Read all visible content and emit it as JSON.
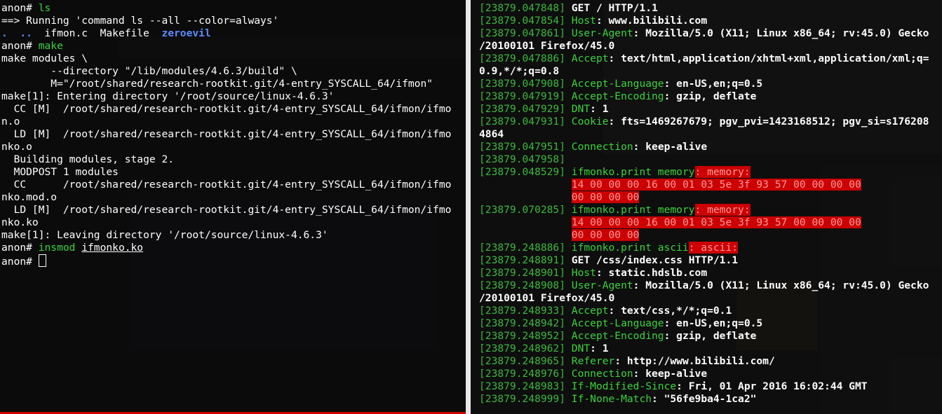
{
  "left_terminal": {
    "lines": [
      [
        {
          "t": "anon# ",
          "c": "prompt"
        },
        {
          "t": "ls",
          "c": "cmd-ls"
        }
      ],
      [
        {
          "t": "==> Running 'command ls --all --color=always'",
          "c": ""
        }
      ],
      [
        {
          "t": ".  ..  ",
          "c": "file-dir"
        },
        {
          "t": "ifmon.c  Makefile  ",
          "c": ""
        },
        {
          "t": "zeroevil",
          "c": "file-dir"
        }
      ],
      [
        {
          "t": "anon# ",
          "c": "prompt"
        },
        {
          "t": "make",
          "c": "cmd-make"
        }
      ],
      [
        {
          "t": "make modules \\",
          "c": ""
        }
      ],
      [
        {
          "t": "        --directory \"/lib/modules/4.6.3/build\" \\",
          "c": ""
        }
      ],
      [
        {
          "t": "        M=\"/root/shared/research-rootkit.git/4-entry_SYSCALL_64/ifmon\"",
          "c": ""
        }
      ],
      [
        {
          "t": "make[1]: Entering directory '/root/source/linux-4.6.3'",
          "c": ""
        }
      ],
      [
        {
          "t": "  CC [M]  /root/shared/research-rootkit.git/4-entry_SYSCALL_64/ifmon/ifmo",
          "c": ""
        }
      ],
      [
        {
          "t": "n.o",
          "c": ""
        }
      ],
      [
        {
          "t": "  LD [M]  /root/shared/research-rootkit.git/4-entry_SYSCALL_64/ifmon/ifmo",
          "c": ""
        }
      ],
      [
        {
          "t": "nko.o",
          "c": ""
        }
      ],
      [
        {
          "t": "  Building modules, stage 2.",
          "c": ""
        }
      ],
      [
        {
          "t": "  MODPOST 1 modules",
          "c": ""
        }
      ],
      [
        {
          "t": "  CC      /root/shared/research-rootkit.git/4-entry_SYSCALL_64/ifmon/ifmo",
          "c": ""
        }
      ],
      [
        {
          "t": "nko.mod.o",
          "c": ""
        }
      ],
      [
        {
          "t": "  LD [M]  /root/shared/research-rootkit.git/4-entry_SYSCALL_64/ifmon/ifmo",
          "c": ""
        }
      ],
      [
        {
          "t": "nko.ko",
          "c": ""
        }
      ],
      [
        {
          "t": "make[1]: Leaving directory '/root/source/linux-4.6.3'",
          "c": ""
        }
      ],
      [
        {
          "t": "anon# ",
          "c": "prompt"
        },
        {
          "t": "insmod ",
          "c": "cmd-insmod"
        },
        {
          "t": "ifmonko.ko",
          "c": "underline"
        }
      ],
      [
        {
          "t": "anon# ",
          "c": "prompt"
        },
        {
          "t": "",
          "c": "cursor"
        }
      ]
    ]
  },
  "right_terminal": {
    "lines": [
      [
        {
          "t": "[23879.047848] ",
          "c": "ts"
        },
        {
          "t": "GET / HTTP/1.1",
          "c": "val"
        }
      ],
      [
        {
          "t": "[23879.047854] ",
          "c": "ts"
        },
        {
          "t": "Host",
          "c": "key"
        },
        {
          "t": ": www.bilibili.com",
          "c": "val"
        }
      ],
      [
        {
          "t": "[23879.047861] ",
          "c": "ts"
        },
        {
          "t": "User-Agent",
          "c": "key"
        },
        {
          "t": ": Mozilla/5.0 (X11; Linux x86_64; rv:45.0) Gecko",
          "c": "val"
        }
      ],
      [
        {
          "t": "/20100101 Firefox/45.0",
          "c": "val"
        }
      ],
      [
        {
          "t": "[23879.047886] ",
          "c": "ts"
        },
        {
          "t": "Accept",
          "c": "key"
        },
        {
          "t": ": text/html,application/xhtml+xml,application/xml;q=",
          "c": "val"
        }
      ],
      [
        {
          "t": "0.9,*/*;q=0.8",
          "c": "val"
        }
      ],
      [
        {
          "t": "[23879.047908] ",
          "c": "ts"
        },
        {
          "t": "Accept-Language",
          "c": "key"
        },
        {
          "t": ": en-US,en;q=0.5",
          "c": "val"
        }
      ],
      [
        {
          "t": "[23879.047919] ",
          "c": "ts"
        },
        {
          "t": "Accept-Encoding",
          "c": "key"
        },
        {
          "t": ": gzip, deflate",
          "c": "val"
        }
      ],
      [
        {
          "t": "[23879.047929] ",
          "c": "ts"
        },
        {
          "t": "DNT",
          "c": "key"
        },
        {
          "t": ": 1",
          "c": "val"
        }
      ],
      [
        {
          "t": "[23879.047931] ",
          "c": "ts"
        },
        {
          "t": "Cookie",
          "c": "key"
        },
        {
          "t": ": fts=1469267679; pgv_pvi=1423168512; pgv_si=s176208",
          "c": "val"
        }
      ],
      [
        {
          "t": "4864",
          "c": "val"
        }
      ],
      [
        {
          "t": "[23879.047951] ",
          "c": "ts"
        },
        {
          "t": "Connection",
          "c": "key"
        },
        {
          "t": ": keep-alive",
          "c": "val"
        }
      ],
      [
        {
          "t": "[23879.047958]",
          "c": "ts"
        }
      ],
      [
        {
          "t": "[23879.048529] ",
          "c": "ts"
        },
        {
          "t": "ifmonko.print memory",
          "c": "key"
        },
        {
          "t": ": memory:",
          "c": "red"
        }
      ],
      [
        {
          "t": "               ",
          "c": ""
        },
        {
          "t": "14 00 00 00 16 00 01 03 5e 3f 93 57 00 00 00 00",
          "c": "red"
        }
      ],
      [
        {
          "t": "               ",
          "c": ""
        },
        {
          "t": "00 00 00 00",
          "c": "red"
        }
      ],
      [
        {
          "t": "[23879.070285] ",
          "c": "ts"
        },
        {
          "t": "ifmonko.print memory",
          "c": "key"
        },
        {
          "t": ": memory:",
          "c": "red"
        }
      ],
      [
        {
          "t": "               ",
          "c": ""
        },
        {
          "t": "14 00 00 00 16 00 01 03 5e 3f 93 57 00 00 00 00",
          "c": "red"
        }
      ],
      [
        {
          "t": "               ",
          "c": ""
        },
        {
          "t": "00 00 00 00",
          "c": "red"
        }
      ],
      [
        {
          "t": "[23879.248886] ",
          "c": "ts"
        },
        {
          "t": "ifmonko.print ascii",
          "c": "key"
        },
        {
          "t": ": ascii:",
          "c": "red"
        }
      ],
      [
        {
          "t": "[23879.248891] ",
          "c": "ts"
        },
        {
          "t": "GET /css/index.css HTTP/1.1",
          "c": "val"
        }
      ],
      [
        {
          "t": "[23879.248901] ",
          "c": "ts"
        },
        {
          "t": "Host",
          "c": "key"
        },
        {
          "t": ": static.hdslb.com",
          "c": "val"
        }
      ],
      [
        {
          "t": "[23879.248908] ",
          "c": "ts"
        },
        {
          "t": "User-Agent",
          "c": "key"
        },
        {
          "t": ": Mozilla/5.0 (X11; Linux x86_64; rv:45.0) Gecko",
          "c": "val"
        }
      ],
      [
        {
          "t": "/20100101 Firefox/45.0",
          "c": "val"
        }
      ],
      [
        {
          "t": "[23879.248933] ",
          "c": "ts"
        },
        {
          "t": "Accept",
          "c": "key"
        },
        {
          "t": ": text/css,*/*;q=0.1",
          "c": "val"
        }
      ],
      [
        {
          "t": "[23879.248942] ",
          "c": "ts"
        },
        {
          "t": "Accept-Language",
          "c": "key"
        },
        {
          "t": ": en-US,en;q=0.5",
          "c": "val"
        }
      ],
      [
        {
          "t": "[23879.248952] ",
          "c": "ts"
        },
        {
          "t": "Accept-Encoding",
          "c": "key"
        },
        {
          "t": ": gzip, deflate",
          "c": "val"
        }
      ],
      [
        {
          "t": "[23879.248962] ",
          "c": "ts"
        },
        {
          "t": "DNT",
          "c": "key"
        },
        {
          "t": ": 1",
          "c": "val"
        }
      ],
      [
        {
          "t": "[23879.248965] ",
          "c": "ts"
        },
        {
          "t": "Referer",
          "c": "key"
        },
        {
          "t": ": http://www.bilibili.com/",
          "c": "val"
        }
      ],
      [
        {
          "t": "[23879.248976] ",
          "c": "ts"
        },
        {
          "t": "Connection",
          "c": "key"
        },
        {
          "t": ": keep-alive",
          "c": "val"
        }
      ],
      [
        {
          "t": "[23879.248983] ",
          "c": "ts"
        },
        {
          "t": "If-Modified-Since",
          "c": "key"
        },
        {
          "t": ": Fri, 01 Apr 2016 16:02:44 GMT",
          "c": "val"
        }
      ],
      [
        {
          "t": "[23879.248999] ",
          "c": "ts"
        },
        {
          "t": "If-None-Match",
          "c": "key"
        },
        {
          "t": ": \"56fe9ba4-1ca2\"",
          "c": "val"
        }
      ]
    ]
  },
  "colors": {
    "timestamp": "#3cb83c",
    "command": "#3ad33a",
    "directory": "#5a8cff",
    "highlight": "#cc0000"
  }
}
